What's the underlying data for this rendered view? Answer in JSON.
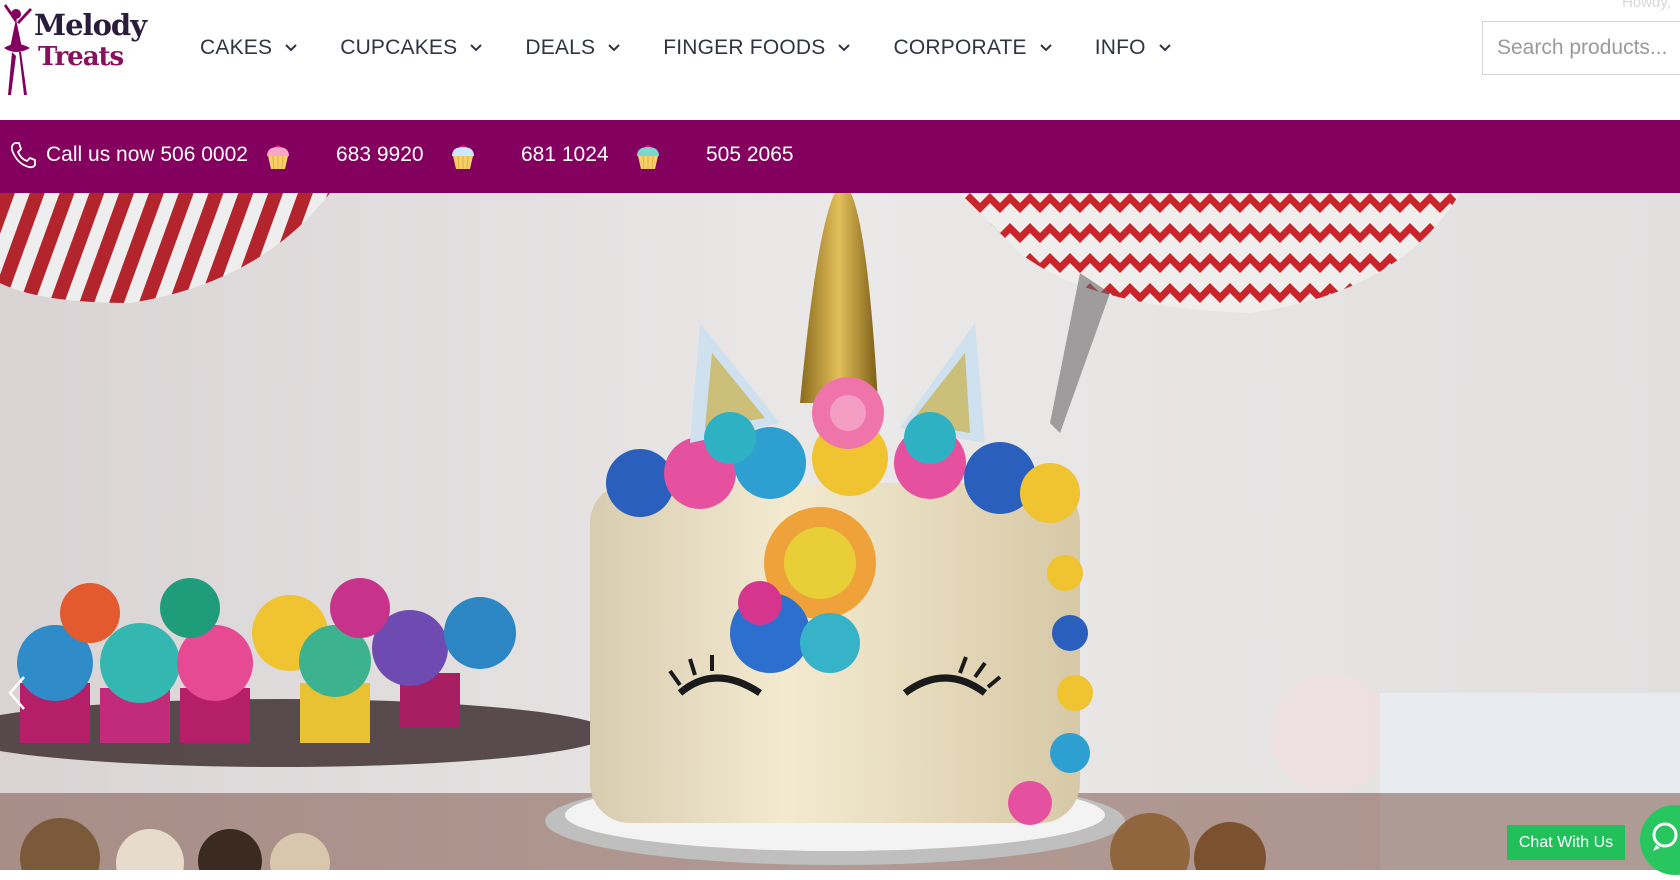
{
  "logo": {
    "line1": "Melody",
    "line2": "Treats"
  },
  "nav": [
    {
      "label": "CAKES"
    },
    {
      "label": "CUPCAKES"
    },
    {
      "label": "DEALS"
    },
    {
      "label": "FINGER FOODS"
    },
    {
      "label": "CORPORATE"
    },
    {
      "label": "INFO"
    }
  ],
  "howdy": "Howdy,",
  "search": {
    "placeholder": "Search products..."
  },
  "phonebar": {
    "call_label": "Call us now 506 0002",
    "numbers": [
      "683 9920",
      "681 1024",
      "505 2065"
    ]
  },
  "icons": {
    "phone": "phone-icon",
    "cupcake": "cupcake-icon",
    "chevron": "chevron-down-icon",
    "prev": "chevron-left-icon",
    "whatsapp": "whatsapp-icon"
  },
  "colors": {
    "brand": "#84005f",
    "logo_dark": "#2a1d3c",
    "chat_green": "#22c05b"
  },
  "chat": {
    "label": "Chat With Us"
  }
}
